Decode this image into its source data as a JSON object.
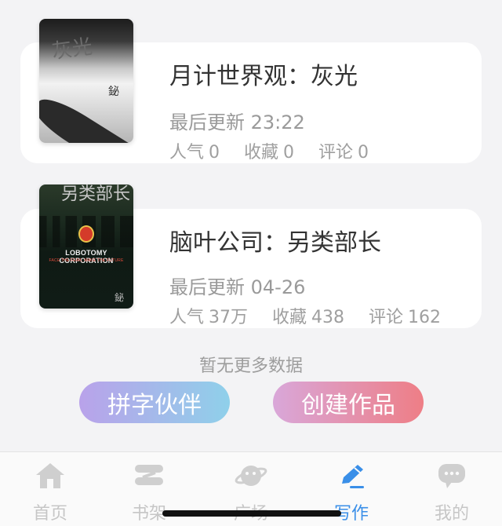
{
  "works": [
    {
      "title": "月计世界观：灰光",
      "updated_label": "最后更新",
      "updated_value": "23:22",
      "stats": [
        {
          "label": "人气",
          "value": "0"
        },
        {
          "label": "收藏",
          "value": "0"
        },
        {
          "label": "评论",
          "value": "0"
        }
      ],
      "cover": {
        "glyph": "灰光",
        "seal": "鉍"
      }
    },
    {
      "title": "脑叶公司：另类部长",
      "updated_label": "最后更新",
      "updated_value": "04-26",
      "stats": [
        {
          "label": "人气",
          "value": "37万"
        },
        {
          "label": "收藏",
          "value": "438"
        },
        {
          "label": "评论",
          "value": "162"
        }
      ],
      "cover": {
        "glyph": "另类部长",
        "title": "LOBOTOMY CORPORATION",
        "tagline": "FACE THE FEAR, MAKE THE FUTURE",
        "seal": "鉍"
      }
    }
  ],
  "no_more_text": "暂无更多数据",
  "buttons": {
    "partner": "拼字伙伴",
    "create": "创建作品"
  },
  "tabbar": {
    "items": [
      {
        "label": "首页",
        "icon": "home-icon"
      },
      {
        "label": "书架",
        "icon": "bookshelf-icon"
      },
      {
        "label": "广场",
        "icon": "planet-icon"
      },
      {
        "label": "写作",
        "icon": "pen-icon",
        "active": true
      },
      {
        "label": "我的",
        "icon": "chat-bubble-icon"
      }
    ],
    "active_color": "#3a8fe8",
    "inactive_color": "#c6c6c6"
  },
  "colors": {
    "background": "#f3f3f5",
    "card": "#ffffff",
    "partner_gradient": [
      "#b9a2ea",
      "#8fd0ea"
    ],
    "create_gradient": [
      "#d9a7d9",
      "#ee7e86"
    ]
  }
}
